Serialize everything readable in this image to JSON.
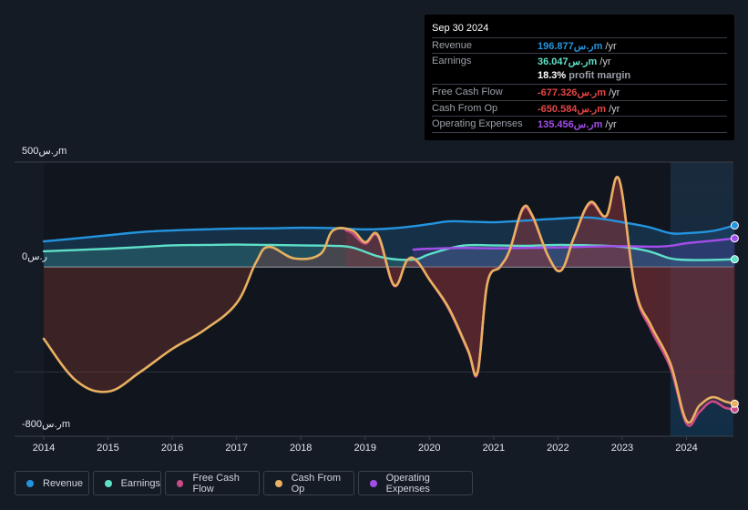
{
  "tooltip": {
    "date": "Sep 30 2024",
    "rows": [
      {
        "label": "Revenue",
        "value": "196.877ر.سm",
        "suffix": " /yr",
        "color": "#2394df"
      },
      {
        "label": "Earnings",
        "value": "36.047ر.سm",
        "suffix": " /yr",
        "color": "#5ee0c8"
      },
      {
        "label": "",
        "value": "18.3%",
        "suffix": " profit margin",
        "color": "#ffffff"
      },
      {
        "label": "Free Cash Flow",
        "value": "-677.326ر.سm",
        "suffix": " /yr",
        "color": "#e64545"
      },
      {
        "label": "Cash From Op",
        "value": "-650.584ر.سm",
        "suffix": " /yr",
        "color": "#e64545"
      },
      {
        "label": "Operating Expenses",
        "value": "135.456ر.سm",
        "suffix": " /yr",
        "color": "#a24ee8"
      }
    ]
  },
  "legend": [
    {
      "label": "Revenue",
      "color": "#2394df"
    },
    {
      "label": "Earnings",
      "color": "#5ee0c8"
    },
    {
      "label": "Free Cash Flow",
      "color": "#c84a86"
    },
    {
      "label": "Cash From Op",
      "color": "#e8b060"
    },
    {
      "label": "Operating Expenses",
      "color": "#a24ee8"
    }
  ],
  "chart_data": {
    "type": "area",
    "title": "",
    "currency_unit": "ر.سm",
    "y_tick_labels": [
      "500ر.سm",
      "0ر.س",
      "-800ر.سm"
    ],
    "y_ticks": [
      500,
      0,
      -800
    ],
    "ylim": [
      -800,
      500
    ],
    "xlim": [
      2013.6,
      2024.75
    ],
    "x_tick_labels": [
      "2014",
      "2015",
      "2016",
      "2017",
      "2018",
      "2019",
      "2020",
      "2021",
      "2022",
      "2023",
      "2024"
    ],
    "forecast_shade_start": 2023.75,
    "grid": true,
    "legend_position": "bottom",
    "series": [
      {
        "name": "Revenue",
        "color": "#2394df",
        "x": [
          2014,
          2014.5,
          2015,
          2015.5,
          2016,
          2016.5,
          2017,
          2017.5,
          2018,
          2018.5,
          2019,
          2019.5,
          2020,
          2020.3,
          2020.7,
          2021,
          2021.5,
          2022,
          2022.5,
          2023,
          2023.4,
          2023.75,
          2024,
          2024.4,
          2024.75
        ],
        "y": [
          121,
          135,
          150,
          165,
          173,
          178,
          182,
          183,
          186,
          184,
          178,
          185,
          203,
          216,
          214,
          212,
          220,
          229,
          234,
          212,
          190,
          160,
          160,
          170,
          196.877
        ]
      },
      {
        "name": "Earnings",
        "color": "#5ee0c8",
        "x": [
          2014,
          2014.5,
          2015,
          2015.5,
          2016,
          2016.5,
          2017,
          2017.5,
          2018,
          2018.5,
          2018.8,
          2019.2,
          2019.5,
          2019.8,
          2020,
          2020.5,
          2021,
          2021.5,
          2022,
          2022.5,
          2023,
          2023.4,
          2023.75,
          2024,
          2024.4,
          2024.75
        ],
        "y": [
          74,
          80,
          86,
          94,
          102,
          104,
          106,
          104,
          102,
          100,
          92,
          50,
          35,
          36,
          60,
          100,
          102,
          100,
          104,
          102,
          95,
          75,
          40,
          33,
          33,
          36.047
        ]
      },
      {
        "name": "Free Cash Flow",
        "color": "#c84a86",
        "x": [
          2018.7,
          2018.8,
          2019,
          2019.2,
          2019.45,
          2019.65,
          2019.8,
          2020,
          2020.3,
          2020.6,
          2020.75,
          2020.9,
          2021.1,
          2021.25,
          2021.45,
          2021.6,
          2021.85,
          2022.05,
          2022.25,
          2022.5,
          2022.75,
          2022.95,
          2023.2,
          2023.45,
          2023.75,
          2024,
          2024.2,
          2024.4,
          2024.6,
          2024.75
        ],
        "y": [
          173,
          160,
          110,
          145,
          -90,
          30,
          30,
          -60,
          -200,
          -400,
          -505,
          -80,
          0,
          80,
          270,
          240,
          50,
          -17,
          140,
          300,
          240,
          416,
          -110,
          -300,
          -480,
          -745,
          -690,
          -640,
          -670,
          -677.326
        ]
      },
      {
        "name": "Cash From Op",
        "color": "#e8b060",
        "x": [
          2014,
          2014.5,
          2015,
          2015.5,
          2016,
          2016.5,
          2017,
          2017.3,
          2017.5,
          2017.9,
          2018.3,
          2018.5,
          2018.8,
          2019,
          2019.2,
          2019.45,
          2019.65,
          2019.8,
          2020,
          2020.3,
          2020.6,
          2020.75,
          2020.9,
          2021.1,
          2021.25,
          2021.45,
          2021.6,
          2021.85,
          2022.05,
          2022.25,
          2022.5,
          2022.75,
          2022.95,
          2023.2,
          2023.45,
          2023.75,
          2024,
          2024.2,
          2024.4,
          2024.6,
          2024.75
        ],
        "y": [
          -342,
          -540,
          -593,
          -500,
          -390,
          -300,
          -173,
          20,
          95,
          40,
          60,
          173,
          173,
          117,
          151,
          -87,
          30,
          30,
          -60,
          -195,
          -395,
          -500,
          -80,
          0,
          80,
          277,
          245,
          50,
          -17,
          140,
          307,
          242,
          416,
          -100,
          -280,
          -460,
          -732,
          -660,
          -620,
          -640,
          -650.584
        ]
      },
      {
        "name": "Operating Expenses",
        "color": "#a24ee8",
        "x": [
          2019.75,
          2020,
          2020.5,
          2021,
          2021.5,
          2022,
          2022.5,
          2023,
          2023.5,
          2023.75,
          2024,
          2024.4,
          2024.75
        ],
        "y": [
          82,
          86,
          90,
          88,
          90,
          92,
          96,
          98,
          96,
          100,
          112,
          124,
          135.456
        ]
      }
    ]
  }
}
